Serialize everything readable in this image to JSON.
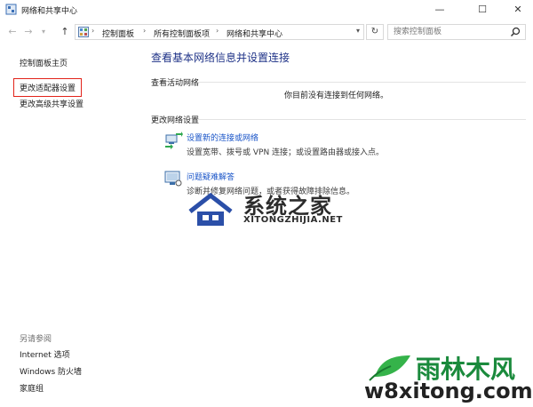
{
  "window": {
    "title": "网络和共享中心",
    "minimize": "—",
    "maximize": "☐",
    "close": "✕"
  },
  "nav": {
    "back": "←",
    "forward": "→",
    "history": "▾",
    "up": "↑",
    "breadcrumbs": [
      "控制面板",
      "所有控制面板项",
      "网络和共享中心"
    ],
    "separator": "›",
    "dropdown": "▾",
    "refresh": "↻",
    "search_placeholder": "搜索控制面板"
  },
  "left_pane": {
    "home": "控制面板主页",
    "change_adapter": "更改适配器设置",
    "advanced_sharing": "更改高级共享设置",
    "see_also": "另请参阅",
    "links": [
      "Internet 选项",
      "Windows 防火墙",
      "家庭组"
    ]
  },
  "main": {
    "title": "查看基本网络信息并设置连接",
    "active_networks_label": "查看活动网络",
    "not_connected": "你目前没有连接到任何网络。",
    "change_settings_label": "更改网络设置",
    "tasks": [
      {
        "label": "设置新的连接或网络",
        "desc": "设置宽带、拨号或 VPN 连接；或设置路由器或接入点。"
      },
      {
        "label": "问题疑难解答",
        "desc": "诊断并修复网络问题，或者获得故障排除信息。"
      }
    ]
  },
  "watermark_1": {
    "cn": "系统之家",
    "en": "XITONGZHIJIA.NET"
  },
  "watermark_2": {
    "cn": "雨林木风",
    "url": "w8xitong.com"
  },
  "colors": {
    "link": "#1a55c8",
    "heading": "#1e3287",
    "highlight_border": "#e2231a",
    "watermark_green": "#1a8a3c"
  }
}
